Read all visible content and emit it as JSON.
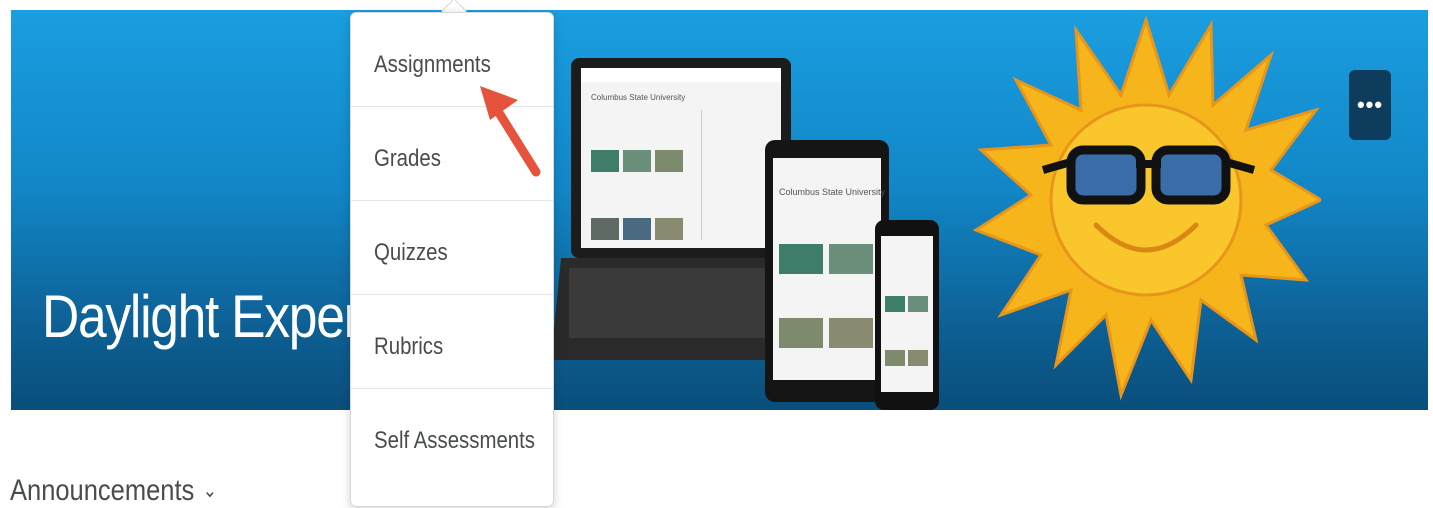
{
  "banner": {
    "title": "Daylight Experience",
    "more_button_label": "•••",
    "device_screen_title": "Columbus State University"
  },
  "dropdown": {
    "items": [
      {
        "label": "Assignments"
      },
      {
        "label": "Grades"
      },
      {
        "label": "Quizzes"
      },
      {
        "label": "Rubrics"
      },
      {
        "label": "Self Assessments"
      }
    ]
  },
  "announcements": {
    "label": "Announcements"
  },
  "colors": {
    "banner_top": "#1a9ee0",
    "banner_bottom": "#0a4e7b",
    "more_button": "#0e3c5c",
    "menu_text": "#494c4e",
    "arrow": "#e5533d",
    "sun": "#f7b51c"
  },
  "icons": [
    "more-horizontal-icon",
    "chevron-down-icon",
    "annotation-arrow-icon",
    "sun-illustration",
    "devices-illustration"
  ]
}
